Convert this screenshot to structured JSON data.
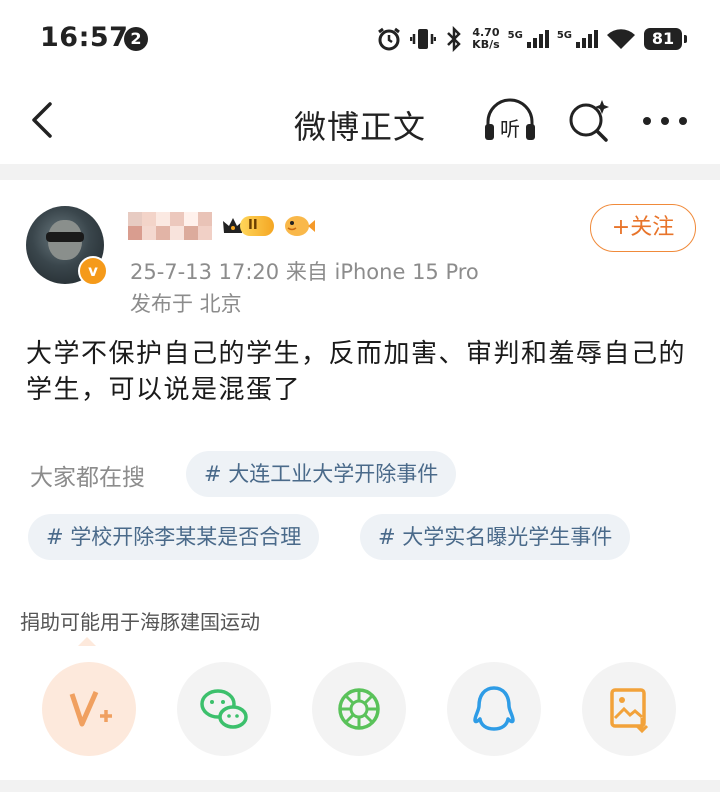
{
  "status_bar": {
    "time": "16:57",
    "notification_count": "2",
    "net_speed_value": "4.70",
    "net_speed_unit": "KB/s",
    "sim1_label": "5G",
    "sim2_label": "5G",
    "battery": "81"
  },
  "nav": {
    "title": "微博正文",
    "listen_label": "听",
    "icons": [
      "back-arrow-icon",
      "listen-headphones-icon",
      "search-sparkle-icon",
      "more-dots-icon"
    ]
  },
  "post": {
    "level_badge": "II",
    "follow_label": "+关注",
    "meta": "25-7-13 17:20  来自 iPhone 15 Pro",
    "location": "发布于 北京",
    "content": "大学不保护自己的学生，反而加害、审判和羞辱自己的学生，可以说是混蛋了"
  },
  "search": {
    "label": "大家都在搜",
    "tags": [
      "# 大连工业大学开除事件",
      "# 学校开除李某某是否合理",
      "# 大学实名曝光学生事件"
    ]
  },
  "donate_text": "捐助可能用于海豚建国运动",
  "share": {
    "items": [
      "weibo-v-plus-icon",
      "wechat-icon",
      "moments-icon",
      "qq-icon",
      "save-image-icon"
    ],
    "colors": {
      "weibo": "#f0a060",
      "wechat": "#3cc06c",
      "moments": "#5ac25a",
      "qq": "#2e9ce6",
      "save": "#f2a23a"
    }
  }
}
